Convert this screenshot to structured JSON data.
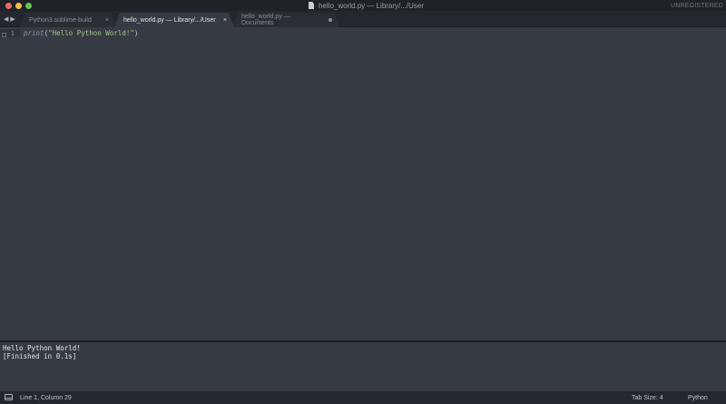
{
  "window": {
    "title": "hello_world.py — Library/.../User",
    "registration": "UNREGISTERED"
  },
  "tabs": [
    {
      "label": "Python3.sublime-build",
      "active": false,
      "state": "close"
    },
    {
      "label": "hello_world.py — Library/.../User",
      "active": true,
      "state": "close"
    },
    {
      "label": "hello_world.py — Documents",
      "active": false,
      "state": "dirty"
    }
  ],
  "icons": {
    "close": "×",
    "back": "◀",
    "forward": "▶"
  },
  "editor": {
    "line_number": "1",
    "code": {
      "function": "print",
      "open_paren": "(",
      "string": "\"Hello Python World!\"",
      "close_paren": ")"
    }
  },
  "output": {
    "lines": [
      "Hello Python World!",
      "[Finished in 0.1s]"
    ]
  },
  "statusbar": {
    "position": "Line 1, Column 29",
    "tab_size": "Tab Size: 4",
    "syntax": "Python"
  },
  "colors": {
    "editor_bg": "#363b43",
    "string": "#a3c586",
    "keyword": "#8d96a3",
    "chrome_bg": "#24272d"
  }
}
